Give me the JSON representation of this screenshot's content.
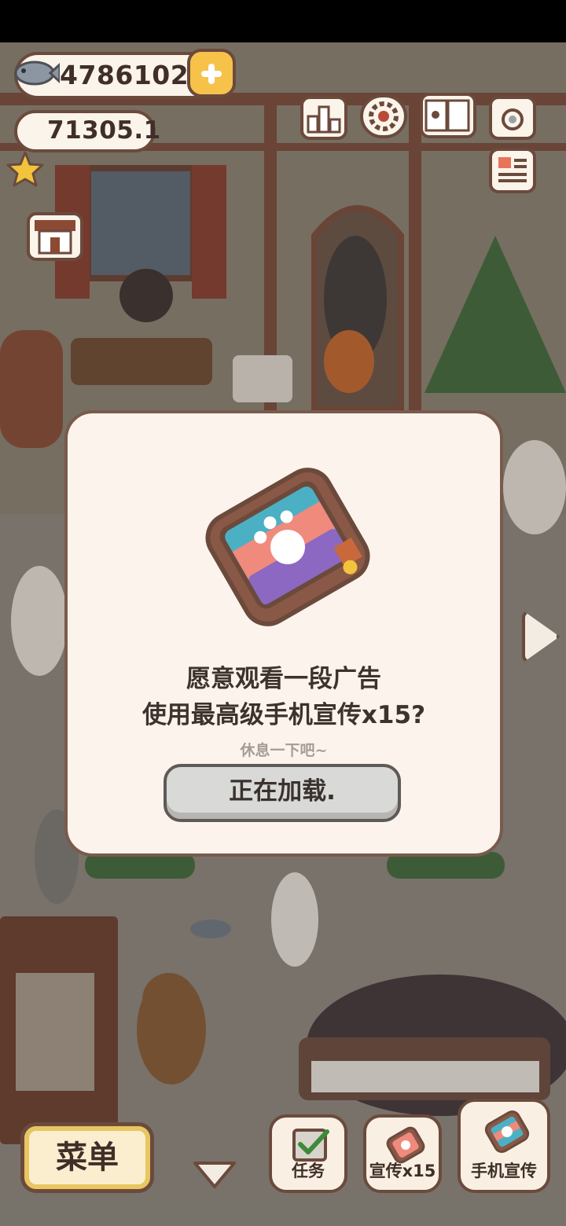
{
  "hud": {
    "fish_count": "4786102",
    "star_count": "71305.1"
  },
  "dialog": {
    "title_line1": "愿意观看一段广告",
    "title_line2": "使用最高级手机宣传x15?",
    "subtitle": "休息一下吧~",
    "button_label": "正在加载."
  },
  "bottom_bar": {
    "menu_label": "菜单",
    "tasks_label": "任务",
    "promo15_label": "宣传x15",
    "phone_promo_label": "手机宣传"
  },
  "colors": {
    "dialog_bg": "#fcf4ec",
    "border_brown": "#6b4a3c",
    "button_gray": "#d9d9d7",
    "gold": "#f6c24a"
  },
  "icons": [
    "fish-icon",
    "star-icon",
    "plus-icon",
    "leaderboard-icon",
    "gear-icon",
    "book-icon",
    "camera-icon",
    "newspaper-icon",
    "shop-icon",
    "phone-promo-icon",
    "checklist-icon",
    "chevron-down-icon",
    "arrow-right-icon"
  ]
}
